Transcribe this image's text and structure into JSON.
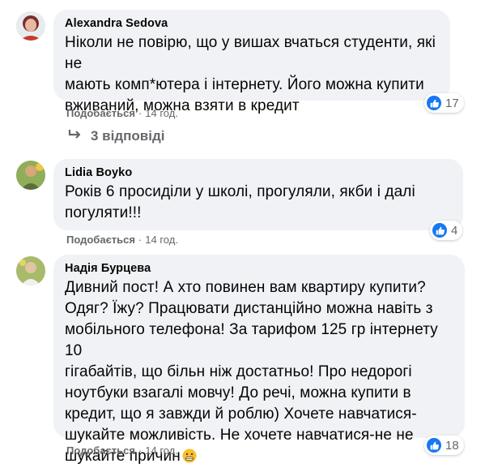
{
  "comments": [
    {
      "author": "Alexandra Sedova",
      "text": "Ніколи не повірю, що у вишах вчаться студенти, які не\nмають комп*ютера і інтернету. Його можна купити\nвживаний, можна взяти в кредит",
      "like_label": "Подобається",
      "time": "14 год.",
      "reactions": "17",
      "replies": "3 відповіді"
    },
    {
      "author": "Lidia Boyko",
      "text": "Років 6 просиділи у школі, прогуляли, якби і далі\nпогуляти!!!",
      "like_label": "Подобається",
      "time": "14 год.",
      "reactions": "4"
    },
    {
      "author": "Надія Бурцева",
      "text": "Дивний пост! А хто повинен вам квартиру купити?\nОдяг? Їжу? Працювати дистанційно можна навіть з\nмобільного телефона! За тарифом 125 гр інтернету 10\nгігабайтів, що більн ніж достатньо! Про недорогі\nноутбуки взагалі мовчу! До речі, можна купити в\nкредит, що я завжди й роблю) Хочете навчатися-\nшукайте можливість. Не хочете навчатися-не не\nшукайте причин",
      "like_label": "Подобається",
      "time": "14 год.",
      "reactions": "18"
    }
  ],
  "icons": {
    "reaction": "thumbs-up-icon",
    "reply_arrow": "reply-arrow-icon",
    "emoji": "grimacing-face-emoji-icon"
  },
  "colors": {
    "bubble": "#f0f2f5",
    "meta_text": "#65676b",
    "like_blue": "#1877f2"
  }
}
